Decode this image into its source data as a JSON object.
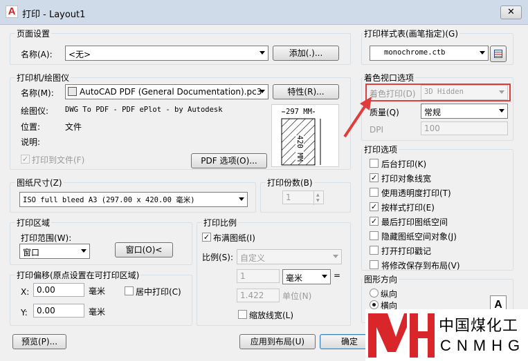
{
  "window": {
    "title": "打印 - Layout1",
    "icon_letter": "A",
    "close_glyph": "✕"
  },
  "page_setup": {
    "group": "页面设置",
    "name_label": "名称(A):",
    "name_value": "<无>",
    "add_button": "添加(.)..."
  },
  "printer": {
    "group": "打印机/绘图仪",
    "name_label": "名称(M):",
    "name_value": "AutoCAD PDF (General Documentation).pc3",
    "properties_button": "特性(R)...",
    "plotter_label": "绘图仪:",
    "plotter_value": "DWG To PDF - PDF ePlot - by Autodesk",
    "location_label": "位置:",
    "location_value": "文件",
    "description_label": "说明:",
    "plot_to_file_label": "打印到文件(F)",
    "plot_to_file_checked": true,
    "pdf_options_button": "PDF 选项(O)...",
    "preview_width": "297 MM",
    "preview_height": "420 MM"
  },
  "paper_size": {
    "group": "图纸尺寸(Z)",
    "value": "ISO full bleed A3 (297.00 x 420.00 毫米)"
  },
  "copies": {
    "group": "打印份数(B)",
    "value": "1"
  },
  "plot_area": {
    "group": "打印区域",
    "range_label": "打印范围(W):",
    "range_value": "窗口",
    "window_button": "窗口(O)<"
  },
  "plot_offset": {
    "group": "打印偏移(原点设置在可打印区域)",
    "x_label": "X:",
    "x_value": "0.00",
    "x_unit": "毫米",
    "y_label": "Y:",
    "y_value": "0.00",
    "y_unit": "毫米",
    "center_label": "居中打印(C)"
  },
  "plot_scale": {
    "group": "打印比例",
    "fit_label": "布满图纸(I)",
    "scale_label": "比例(S):",
    "scale_value": "自定义",
    "value1": "1",
    "unit_value": "毫米",
    "equals": "=",
    "value2": "1.422",
    "unit2": "单位(N)",
    "lineweights_label": "缩放线宽(L)"
  },
  "style_table": {
    "group": "打印样式表(画笔指定)(G)",
    "value": "monochrome.ctb"
  },
  "shaded": {
    "group": "着色视口选项",
    "shade_label": "着色打印(D)",
    "shade_value": "3D Hidden",
    "quality_label": "质量(Q)",
    "quality_value": "常规",
    "dpi_label": "DPI",
    "dpi_value": "100"
  },
  "options": {
    "group": "打印选项",
    "items": [
      {
        "label": "后台打印(K)",
        "checked": false
      },
      {
        "label": "打印对象线宽",
        "checked": true
      },
      {
        "label": "使用透明度打印(T)",
        "checked": false
      },
      {
        "label": "按样式打印(E)",
        "checked": true
      },
      {
        "label": "最后打印图纸空间",
        "checked": true
      },
      {
        "label": "隐藏图纸空间对象(J)",
        "checked": false
      },
      {
        "label": "打开打印戳记",
        "checked": false
      },
      {
        "label": "将修改保存到布局(V)",
        "checked": false
      }
    ]
  },
  "orientation": {
    "group": "图形方向",
    "portrait": "纵向",
    "landscape": "横向",
    "page_letter": "A"
  },
  "footer": {
    "preview_button": "预览(P)...",
    "apply_button": "应用到布局(U)",
    "ok_button": "确定"
  },
  "watermark": {
    "cn": "中国煤化工",
    "en": "CNMHG"
  },
  "colors": {
    "annotation_red": "#e03c3c",
    "watermark_red": "#d9262b"
  }
}
